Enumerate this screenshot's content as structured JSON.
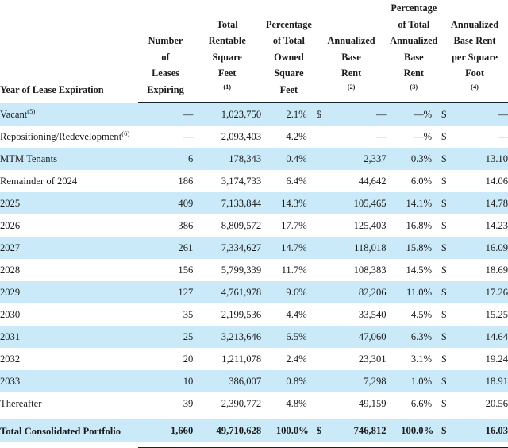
{
  "table": {
    "headers": {
      "label": "Year of Lease Expiration",
      "num_leases": [
        "Number",
        "of",
        "Leases",
        "Expiring"
      ],
      "rentable_sf": [
        "Total",
        "Rentable",
        "Square",
        "Feet"
      ],
      "rentable_sf_note": "(1)",
      "pct_owned_sf": [
        "Percentage",
        "of Total",
        "Owned",
        "Square",
        "Feet"
      ],
      "annualized_base_rent": [
        "Annualized",
        "Base",
        "Rent"
      ],
      "annualized_base_rent_note": "(2)",
      "pct_annualized_base_rent": [
        "Percentage",
        "of Total",
        "Annualized",
        "Base",
        "Rent"
      ],
      "pct_annualized_base_rent_note": "(3)",
      "base_rent_psf": [
        "Annualized",
        "Base Rent",
        "per Square",
        "Foot"
      ],
      "base_rent_psf_note": "(4)"
    },
    "symbols": {
      "percent": "%",
      "dollar": "$",
      "dash": "—"
    },
    "rows": [
      {
        "label": "Vacant",
        "note": "(5)",
        "leases": "—",
        "sf": "1,023,750",
        "pct_sf": "2.1",
        "abr_dollar": "$",
        "abr": "—",
        "pct_abr": "—",
        "psf_dollar": "$",
        "psf": "—",
        "shaded": true
      },
      {
        "label": "Repositioning/Redevelopment",
        "note": "(6)",
        "leases": "—",
        "sf": "2,093,403",
        "pct_sf": "4.2",
        "abr_dollar": "",
        "abr": "—",
        "pct_abr": "—",
        "psf_dollar": "$",
        "psf": "—",
        "shaded": false
      },
      {
        "label": "MTM Tenants",
        "note": "",
        "leases": "6",
        "sf": "178,343",
        "pct_sf": "0.4",
        "abr_dollar": "",
        "abr": "2,337",
        "pct_abr": "0.3",
        "psf_dollar": "$",
        "psf": "13.10",
        "shaded": true
      },
      {
        "label": "Remainder of 2024",
        "note": "",
        "leases": "186",
        "sf": "3,174,733",
        "pct_sf": "6.4",
        "abr_dollar": "",
        "abr": "44,642",
        "pct_abr": "6.0",
        "psf_dollar": "$",
        "psf": "14.06",
        "shaded": false
      },
      {
        "label": "2025",
        "note": "",
        "leases": "409",
        "sf": "7,133,844",
        "pct_sf": "14.3",
        "abr_dollar": "",
        "abr": "105,465",
        "pct_abr": "14.1",
        "psf_dollar": "$",
        "psf": "14.78",
        "shaded": true
      },
      {
        "label": "2026",
        "note": "",
        "leases": "386",
        "sf": "8,809,572",
        "pct_sf": "17.7",
        "abr_dollar": "",
        "abr": "125,403",
        "pct_abr": "16.8",
        "psf_dollar": "$",
        "psf": "14.23",
        "shaded": false
      },
      {
        "label": "2027",
        "note": "",
        "leases": "261",
        "sf": "7,334,627",
        "pct_sf": "14.7",
        "abr_dollar": "",
        "abr": "118,018",
        "pct_abr": "15.8",
        "psf_dollar": "$",
        "psf": "16.09",
        "shaded": true
      },
      {
        "label": "2028",
        "note": "",
        "leases": "156",
        "sf": "5,799,339",
        "pct_sf": "11.7",
        "abr_dollar": "",
        "abr": "108,383",
        "pct_abr": "14.5",
        "psf_dollar": "$",
        "psf": "18.69",
        "shaded": false
      },
      {
        "label": "2029",
        "note": "",
        "leases": "127",
        "sf": "4,761,978",
        "pct_sf": "9.6",
        "abr_dollar": "",
        "abr": "82,206",
        "pct_abr": "11.0",
        "psf_dollar": "$",
        "psf": "17.26",
        "shaded": true
      },
      {
        "label": "2030",
        "note": "",
        "leases": "35",
        "sf": "2,199,536",
        "pct_sf": "4.4",
        "abr_dollar": "",
        "abr": "33,540",
        "pct_abr": "4.5",
        "psf_dollar": "$",
        "psf": "15.25",
        "shaded": false
      },
      {
        "label": "2031",
        "note": "",
        "leases": "25",
        "sf": "3,213,646",
        "pct_sf": "6.5",
        "abr_dollar": "",
        "abr": "47,060",
        "pct_abr": "6.3",
        "psf_dollar": "$",
        "psf": "14.64",
        "shaded": true
      },
      {
        "label": "2032",
        "note": "",
        "leases": "20",
        "sf": "1,211,078",
        "pct_sf": "2.4",
        "abr_dollar": "",
        "abr": "23,301",
        "pct_abr": "3.1",
        "psf_dollar": "$",
        "psf": "19.24",
        "shaded": false
      },
      {
        "label": "2033",
        "note": "",
        "leases": "10",
        "sf": "386,007",
        "pct_sf": "0.8",
        "abr_dollar": "",
        "abr": "7,298",
        "pct_abr": "1.0",
        "psf_dollar": "$",
        "psf": "18.91",
        "shaded": true
      },
      {
        "label": "Thereafter",
        "note": "",
        "leases": "39",
        "sf": "2,390,772",
        "pct_sf": "4.8",
        "abr_dollar": "",
        "abr": "49,159",
        "pct_abr": "6.6",
        "psf_dollar": "$",
        "psf": "20.56",
        "shaded": false
      }
    ],
    "total": {
      "label": "Total Consolidated Portfolio",
      "leases": "1,660",
      "sf": "49,710,628",
      "pct_sf": "100.0",
      "abr_dollar": "$",
      "abr": "746,812",
      "pct_abr": "100.0",
      "psf_dollar": "$",
      "psf": "16.03"
    }
  },
  "colors": {
    "row_shade": "#cbeaf9",
    "rule": "#16232e",
    "text": "#1b1b1b"
  }
}
